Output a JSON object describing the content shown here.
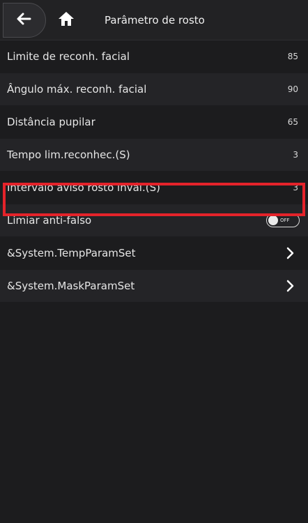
{
  "header": {
    "title": "Parâmetro de rosto",
    "back_icon": "arrow-left-icon",
    "home_icon": "home-icon"
  },
  "settings": [
    {
      "label": "Limite de reconh. facial",
      "value": "85"
    },
    {
      "label": "Ângulo máx. reconh. facial",
      "value": "90"
    },
    {
      "label": "Distância pupilar",
      "value": "65"
    },
    {
      "label": "Tempo lim.reconhec.(S)",
      "value": "3"
    },
    {
      "label": "Intervalo aviso rosto invál.(S)",
      "value": "3"
    },
    {
      "label": "Limiar anti-falso",
      "toggle": "OFF"
    },
    {
      "label": "&System.TempParamSet",
      "icon": "chevron-right-icon"
    },
    {
      "label": "&System.MaskParamSet",
      "icon": "chevron-right-icon"
    }
  ],
  "colors": {
    "background": "#1c1c1e",
    "highlight_border": "#e4232a",
    "text": "#e6e6e6"
  }
}
